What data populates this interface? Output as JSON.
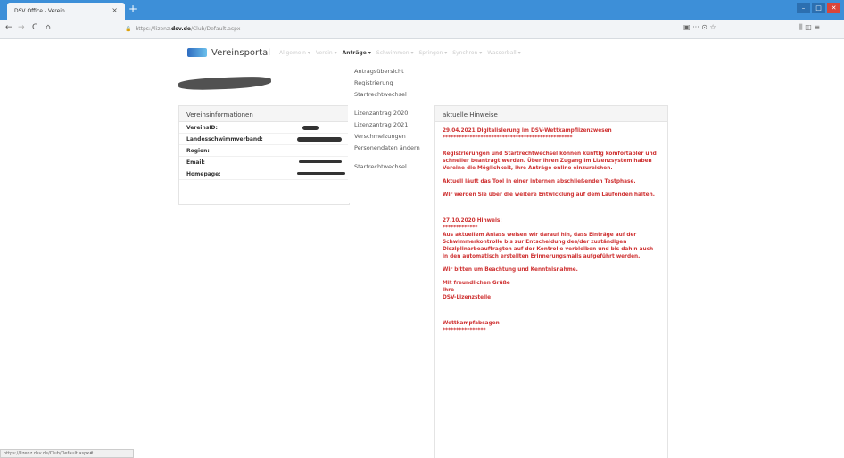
{
  "browser": {
    "tab_title": "DSV Office - Verein",
    "tab_close": "×",
    "new_tab": "+",
    "win_min": "–",
    "win_max": "□",
    "win_close": "✕",
    "nav_back": "←",
    "nav_forward": "→",
    "nav_reload": "C",
    "nav_home": "⌂",
    "url_prefix": "https://lizenz.",
    "url_host": "dsv.de",
    "url_path": "/Club/Default.aspx",
    "right_icons_a": "▣ ··· ⊙ ☆",
    "right_icons_b": "⫼ ◫ ≡",
    "status_url": "https://lizenz.dsv.de/Club/Default.aspx#"
  },
  "nav": {
    "brand": "Vereinsportal",
    "items": [
      {
        "label": "Allgemein ▾",
        "active": false
      },
      {
        "label": "Verein ▾",
        "active": false
      },
      {
        "label": "Anträge ▾",
        "active": true
      },
      {
        "label": "Schwimmen ▾",
        "active": false
      },
      {
        "label": "Springen ▾",
        "active": false
      },
      {
        "label": "Synchron ▾",
        "active": false
      },
      {
        "label": "Wasserball ▾",
        "active": false
      }
    ]
  },
  "dropdown": {
    "group1": [
      "Antragsübersicht",
      "Registrierung",
      "Startrechtwechsel"
    ],
    "group2": [
      "Lizenzantrag 2020",
      "Lizenzantrag 2021",
      "Verschmelzungen",
      "Personendaten ändern"
    ],
    "group3": [
      "Startrechtwechsel"
    ]
  },
  "info": {
    "heading": "Vereinsinformationen",
    "rows": [
      "VereinsID:",
      "Landesschwimmverband:",
      "Region:",
      "Email:",
      "Homepage:"
    ]
  },
  "notes": {
    "heading": "aktuelle Hinweise",
    "n1_title": "29.04.2021 Digitalisierung im DSV-Wettkampflizenzwesen",
    "n1_rule": "************************************************",
    "n1_p1": "Registrierungen und Startrechtwechsel können künftig komfortabler und schneller beantragt werden. Über ihren Zugang im Lizenzsystem haben Vereine die Möglichkeit, ihre Anträge online einzureichen.",
    "n1_p2": "Aktuell läuft das Tool in einer internen abschließenden Testphase.",
    "n1_p3": "Wir werden Sie über die weitere Entwicklung auf dem Laufenden halten.",
    "n2_title": "27.10.2020 Hinweis:",
    "n2_rule": "*************",
    "n2_p1": "Aus aktuellem Anlass weisen wir darauf hin, dass Einträge auf der Schwimmerkontrolle bis zur Entscheidung des/der zuständigen Disziplinarbeauftragten auf der Kontrolle verbleiben und bis dahin auch in den automatisch erstellten Erinnerungsmails aufgeführt werden.",
    "n2_p2": "Wir bitten um Beachtung und Kenntnisnahme.",
    "n2_g1": "Mit freundlichen Grüße",
    "n2_g2": "Ihre",
    "n2_g3": "DSV-Lizenzstelle",
    "n3_title": "Wettkampfabsagen",
    "n3_rule": "****************"
  }
}
